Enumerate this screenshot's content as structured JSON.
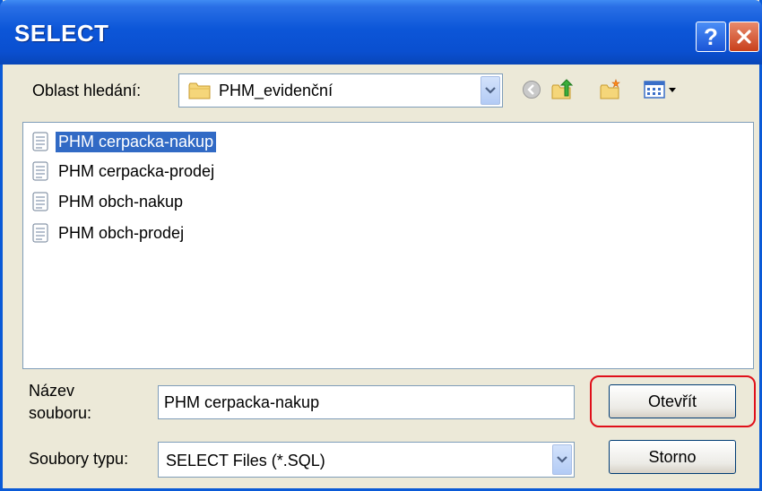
{
  "window": {
    "title": "SELECT",
    "help_label": "?"
  },
  "lookin": {
    "label": "Oblast hledání:",
    "value": "PHM_evidenční"
  },
  "files": [
    {
      "name": "PHM cerpacka-nakup",
      "selected": true
    },
    {
      "name": "PHM cerpacka-prodej",
      "selected": false
    },
    {
      "name": "PHM obch-nakup",
      "selected": false
    },
    {
      "name": "PHM obch-prodej",
      "selected": false
    }
  ],
  "filename": {
    "label_line1": "Název",
    "label_line2": "souboru:",
    "value": "PHM cerpacka-nakup"
  },
  "filetype": {
    "label": "Soubory typu:",
    "value": "SELECT Files (*.SQL)"
  },
  "buttons": {
    "open": "Otevřít",
    "cancel": "Storno"
  },
  "colors": {
    "titlebar": "#0a4fd0",
    "selection": "#316ac5",
    "highlight_ring": "#e0101a"
  }
}
